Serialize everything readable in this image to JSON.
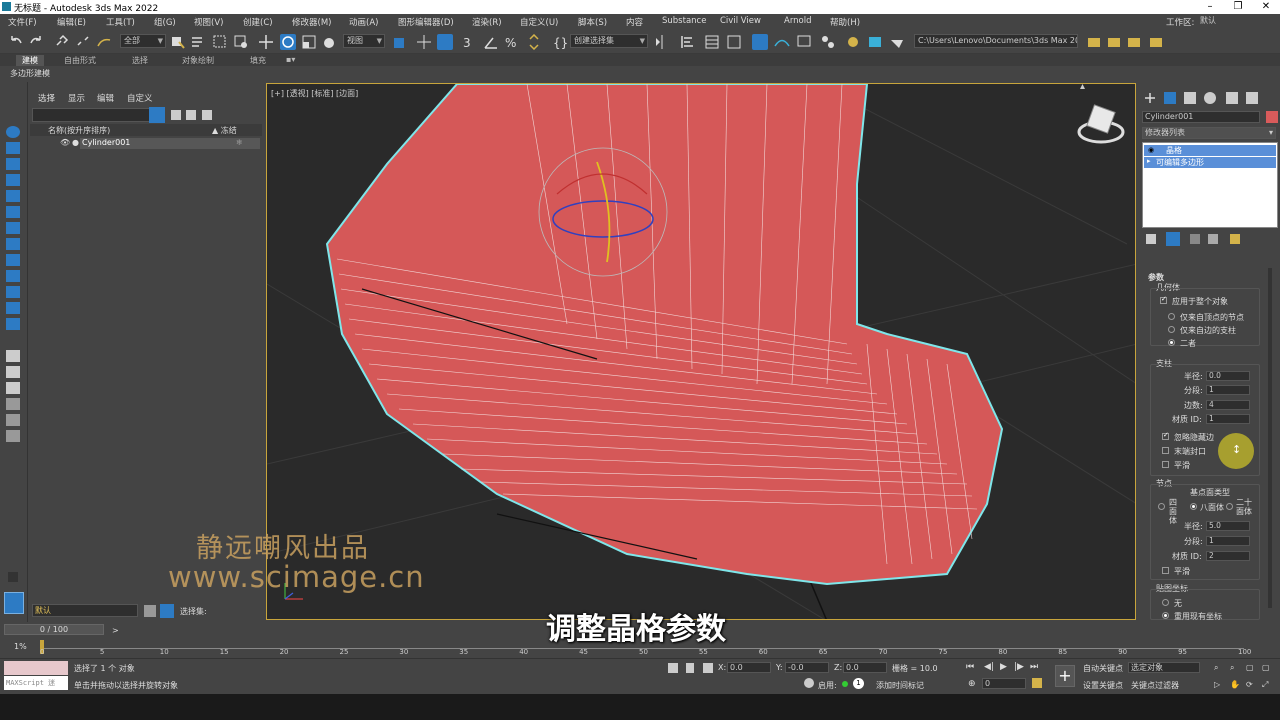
{
  "window": {
    "title": "无标题 - Autodesk 3ds Max 2022"
  },
  "menubar": [
    "文件(F)",
    "编辑(E)",
    "工具(T)",
    "组(G)",
    "视图(V)",
    "创建(C)",
    "修改器(M)",
    "动画(A)",
    "图形编辑器(D)",
    "渲染(R)",
    "自定义(U)",
    "脚本(S)",
    "内容",
    "Substance",
    "Civil View",
    "Arnold",
    "帮助(H)"
  ],
  "workspace": {
    "label": "工作区:",
    "value": "默认"
  },
  "toolbar": {
    "selection_filter": "全部",
    "ref_coord": "视图",
    "named_selection": "创建选择集",
    "project_path": "C:\\Users\\Lenovo\\Documents\\3ds Max 2022"
  },
  "ribbon": {
    "tabs": [
      "建模",
      "自由形式",
      "选择",
      "对象绘制",
      "填充"
    ],
    "sub_label": "多边形建模"
  },
  "explorer": {
    "menus": [
      "选择",
      "显示",
      "编辑",
      "自定义"
    ],
    "col_name": "名称(按升序排序)",
    "col_frozen": "▲ 冻结",
    "object": "Cylinder001",
    "layer": "默认",
    "selection_set_label": "选择集:"
  },
  "viewport": {
    "label": "[+] [透视] [标准] [边面]"
  },
  "watermark": {
    "line1": "静远嘲风出品",
    "line2": "www.scimage.cn"
  },
  "subtitle": "调整晶格参数",
  "command_panel": {
    "object_name": "Cylinder001",
    "object_color": "#d95b5b",
    "modifier_list": "修改器列表",
    "stack": [
      "晶格",
      "可编辑多边形"
    ],
    "rollout": "参数",
    "geometry_label": "几何体",
    "apply_all": "应用于整个对象",
    "geo_opts": [
      "仅来自顶点的节点",
      "仅来自边的支柱",
      "二者"
    ],
    "struts_label": "支柱",
    "radius_label": "半径:",
    "radius_value": "0.0",
    "segments_label": "分段:",
    "segments_value": "1",
    "sides_label": "边数:",
    "sides_value": "4",
    "matid_label": "材质 ID:",
    "matid_value": "1",
    "ignore_hidden": "忽略隐藏边",
    "end_caps": "末端封口",
    "smooth": "平滑",
    "joints_label": "节点",
    "geodesic_label": "基点面类型",
    "joint_types": [
      "四面体",
      "八面体",
      "二十面体"
    ],
    "j_radius_value": "5.0",
    "j_segments_value": "1",
    "j_matid_value": "2",
    "j_smooth": "平滑",
    "mapping_label": "贴图坐标",
    "mapping_opts": [
      "无",
      "重用现有坐标"
    ]
  },
  "timeline": {
    "frame": "0 / 100",
    "ticks": [
      "0",
      "5",
      "10",
      "15",
      "20",
      "25",
      "30",
      "35",
      "40",
      "45",
      "50",
      "55",
      "60",
      "65",
      "70",
      "75",
      "80",
      "85",
      "90",
      "95",
      "100"
    ]
  },
  "status": {
    "maxscript": "MAXScript 迷",
    "selected": "选择了 1 个 对象",
    "hint": "单击并拖动以选择并旋转对象",
    "x_label": "X:",
    "x": "0.0",
    "y_label": "Y:",
    "y": "-0.0",
    "z_label": "Z:",
    "z": "0.0",
    "grid": "栅格 = 10.0",
    "enable": "启用:",
    "add_time_tag": "添加时间标记",
    "auto_key": "自动关键点",
    "set_key": "设置关键点",
    "selected_obj": "选定对象",
    "key_filter": "关键点过滤器",
    "frame_field": "0",
    "percent": "1%"
  }
}
